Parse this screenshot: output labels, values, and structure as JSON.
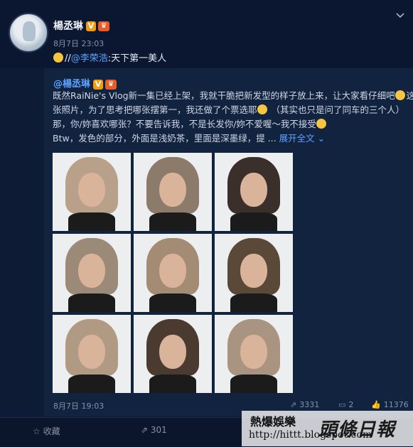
{
  "post": {
    "user_name": "楊丞琳",
    "verified_badge": "V",
    "crown_badge": "♛",
    "time": "8月7日 23:03",
    "repost_prefix": "//",
    "mention": "@李荣浩",
    "repost_text": ":天下第一美人"
  },
  "original": {
    "user_name": "@楊丞琳",
    "lines": [
      "既然RaiNie's Vlog新一集已经上架，我就干脆把新发型的样子放上来，让大家看仔细吧",
      "这九",
      "张照片，为了思考把哪张摆第一，我还做了个票选耶",
      "（其实也只是问了同车的三个人）",
      "那，你/妳喜欢哪张？不要告诉我，不是长发你/妳不爱喔～我不接受",
      "Btw，发色的部分，外面是浅奶茶，里面是深墨绿，提 ..."
    ],
    "expand_label": "展开全文",
    "time": "8月7日 19:03",
    "repost_count": "3331",
    "comment_count": "2",
    "like_count": "11376"
  },
  "photos": [
    {
      "hair": "#b9a08a"
    },
    {
      "hair": "#8c7a6a"
    },
    {
      "hair": "#3a2f2a"
    },
    {
      "hair": "#9c8a78"
    },
    {
      "hair": "#a48c74"
    },
    {
      "hair": "#5a4838"
    },
    {
      "hair": "#b09a84"
    },
    {
      "hair": "#4a3a30"
    },
    {
      "hair": "#a89480"
    }
  ],
  "action_bar": {
    "favorite_label": "收藏",
    "repost_count": "301"
  },
  "watermark": {
    "title": "熱爆娛樂",
    "brand": "頭條日報",
    "url": "http://hittt.blogspot.com"
  },
  "colors": {
    "background": "#0e1b34",
    "link": "#5aa2ff"
  }
}
